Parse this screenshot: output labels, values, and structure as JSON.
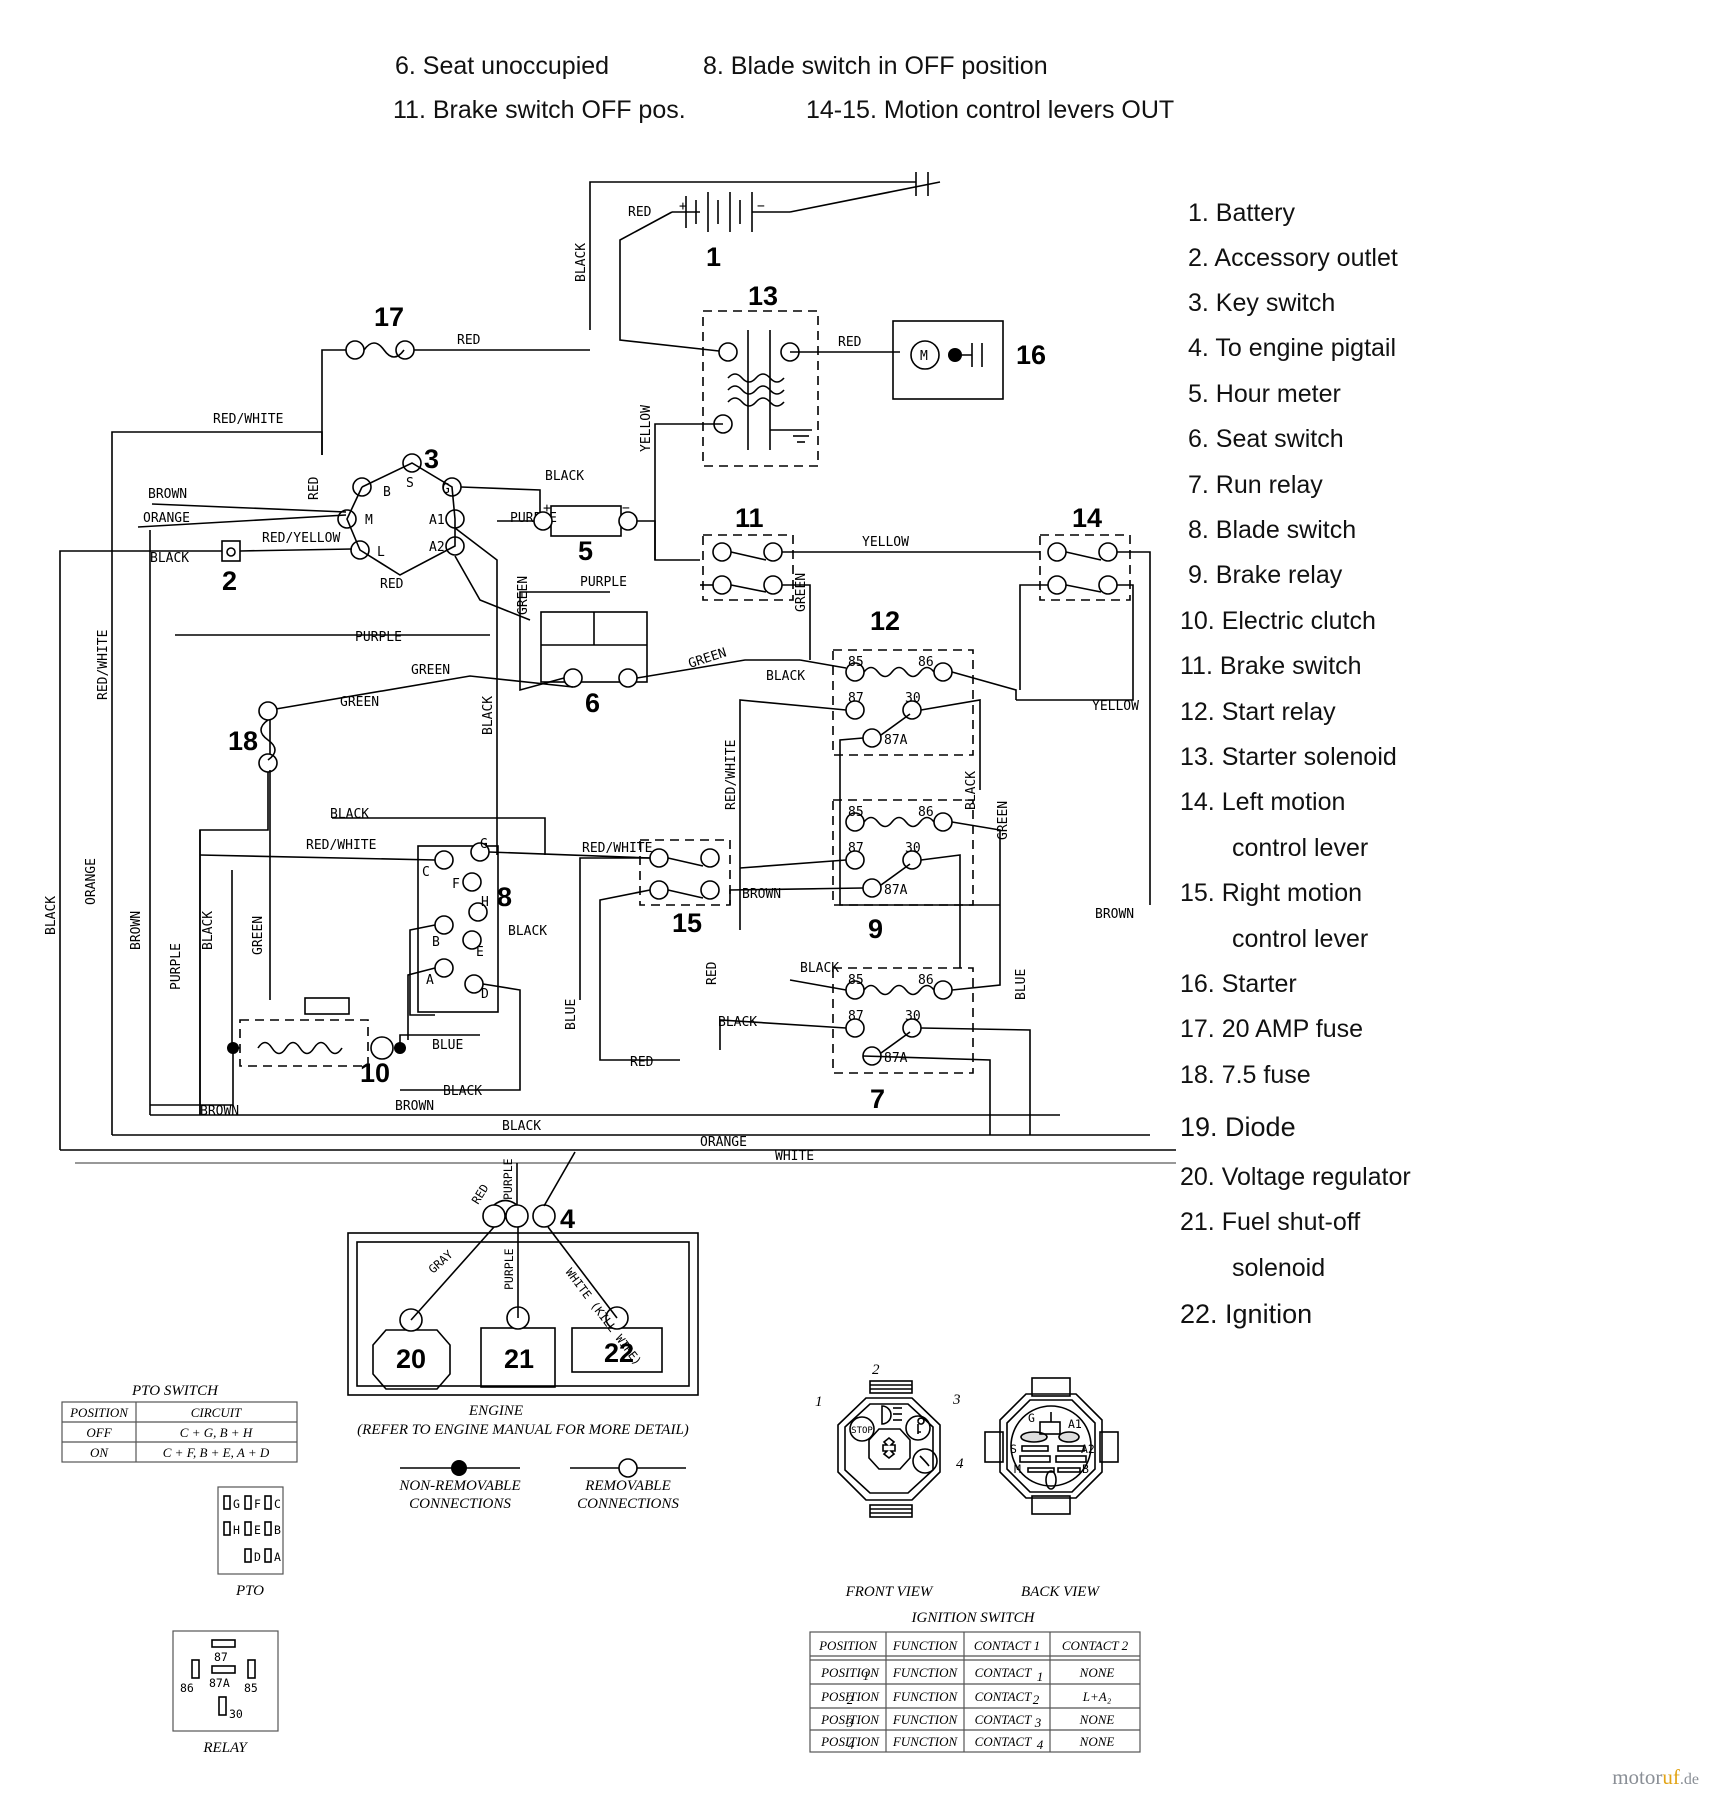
{
  "header": {
    "notes": [
      "6. Seat unoccupied",
      "8. Blade switch in OFF position",
      "11. Brake switch OFF pos.",
      "14-15. Motion control levers OUT"
    ]
  },
  "legend": {
    "items": [
      "1. Battery",
      "2. Accessory outlet",
      "3. Key switch",
      "4. To engine pigtail",
      "5. Hour meter",
      "6. Seat switch",
      "7. Run relay",
      "8. Blade switch",
      "9. Brake relay",
      "10. Electric clutch",
      "11. Brake switch",
      "12. Start relay",
      "13. Starter solenoid",
      "14. Left motion",
      "control lever",
      "15. Right motion",
      "control lever",
      "16. Starter",
      "17. 20 AMP fuse",
      "18. 7.5 fuse",
      "19. Diode",
      "20. Voltage regulator",
      "21. Fuel shut-off",
      "solenoid",
      "22. Ignition"
    ]
  },
  "callouts": {
    "n1": "1",
    "n2": "2",
    "n3": "3",
    "n4": "4",
    "n5": "5",
    "n6": "6",
    "n7": "7",
    "n8": "8",
    "n9": "9",
    "n10": "10",
    "n11": "11",
    "n12": "12",
    "n13": "13",
    "n14": "14",
    "n15": "15",
    "n16": "16",
    "n17": "17",
    "n18": "18",
    "n20": "20",
    "n21": "21",
    "n22": "22"
  },
  "wire_labels": {
    "red": "RED",
    "black": "BLACK",
    "yellow": "YELLOW",
    "green": "GREEN",
    "purple": "PURPLE",
    "blue": "BLUE",
    "brown": "BROWN",
    "orange": "ORANGE",
    "white": "WHITE",
    "gray": "GRAY",
    "red_white": "RED/WHITE",
    "red_yellow": "RED/YELLOW",
    "white_kill": "WHITE (KILL WIRE)"
  },
  "key_switch_terminals": [
    "S",
    "G",
    "B",
    "M",
    "L",
    "A1",
    "A2"
  ],
  "relay_terminals": {
    "t85": "85",
    "t86": "86",
    "t87": "87",
    "t30": "30",
    "t87a": "87A"
  },
  "blade_switch_terminals": [
    "G",
    "C",
    "F",
    "H",
    "B",
    "E",
    "A",
    "D"
  ],
  "pto_switch_table": {
    "title": "PTO SWITCH",
    "headers": [
      "POSITION",
      "CIRCUIT"
    ],
    "rows": [
      [
        "OFF",
        "C + G,  B + H"
      ],
      [
        "ON",
        "C + F,  B + E,  A + D"
      ]
    ]
  },
  "pto_connector": {
    "label": "PTO",
    "rows": [
      [
        "G",
        "F",
        "C"
      ],
      [
        "H",
        "E",
        "B"
      ],
      [
        "",
        "D",
        "A"
      ]
    ]
  },
  "relay_box": {
    "label": "RELAY",
    "pins": {
      "top": "87",
      "left": "86",
      "center": "87A",
      "right": "85",
      "bottom": "30"
    }
  },
  "engine_box": {
    "title": "ENGINE",
    "subtitle": "(REFER TO ENGINE MANUAL FOR MORE DETAIL)",
    "components": [
      "20",
      "21",
      "22"
    ]
  },
  "connection_legend": {
    "non_removable": [
      "NON-REMOVABLE",
      "CONNECTIONS"
    ],
    "removable": [
      "REMOVABLE",
      "CONNECTIONS"
    ]
  },
  "ignition_views": {
    "front_label": "FRONT VIEW",
    "back_label": "BACK VIEW",
    "front_positions": [
      "1",
      "2",
      "3",
      "4"
    ],
    "front_icons": [
      "STOP",
      "lamp-icon",
      "key-icon",
      "start-icon"
    ],
    "back_terminals": [
      "G",
      "A1",
      "S",
      "A2",
      "M",
      "B"
    ]
  },
  "ignition_table": {
    "title": "IGNITION SWITCH",
    "headers": [
      "POSITION",
      "FUNCTION",
      "CONTACT 1",
      "CONTACT 2"
    ],
    "rows": [
      [
        "POSITION",
        "1",
        "FUNCTION",
        "CONTACT",
        "1",
        "NONE"
      ],
      [
        "POSITION",
        "2",
        "FUNCTION",
        "CONTACT",
        "2",
        "L+A₂"
      ],
      [
        "POSITION",
        "3",
        "FUNCTION",
        "CONTACT",
        "3",
        "NONE"
      ],
      [
        "POSITION",
        "4",
        "FUNCTION",
        "CONTACT",
        "4",
        "NONE"
      ]
    ]
  },
  "watermark": {
    "m": "motor",
    "o": "uf",
    "rest": "",
    "d": ".de"
  }
}
